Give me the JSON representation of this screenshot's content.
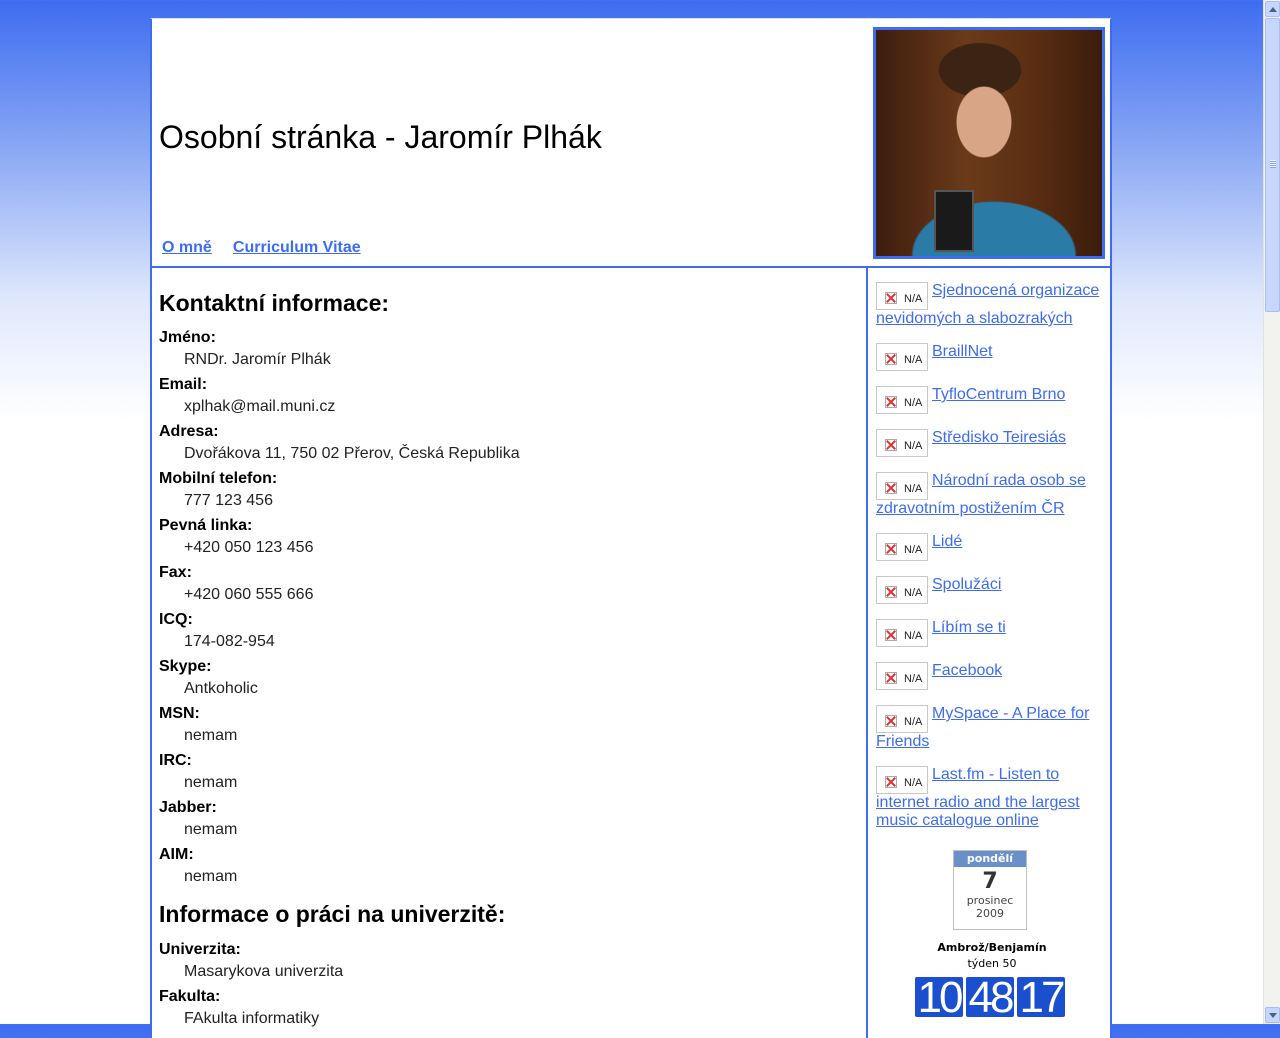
{
  "header": {
    "title": "Osobní stránka - Jaromír Plhák",
    "nav": [
      {
        "label": "O mně"
      },
      {
        "label": "Curriculum Vitae"
      }
    ]
  },
  "contact": {
    "heading": "Kontaktní informace:",
    "fields": [
      {
        "label": "Jméno:",
        "value": "RNDr. Jaromír Plhák"
      },
      {
        "label": "Email:",
        "value": "xplhak@mail.muni.cz"
      },
      {
        "label": "Adresa:",
        "value": "Dvořákova 11, 750 02 Přerov, Česká Republika"
      },
      {
        "label": "Mobilní telefon:",
        "value": "777 123 456"
      },
      {
        "label": "Pevná linka:",
        "value": "+420 050 123 456"
      },
      {
        "label": "Fax:",
        "value": "+420 060 555 666"
      },
      {
        "label": "ICQ:",
        "value": "174-082-954"
      },
      {
        "label": "Skype:",
        "value": "Antkoholic"
      },
      {
        "label": "MSN:",
        "value": "nemam"
      },
      {
        "label": "IRC:",
        "value": "nemam"
      },
      {
        "label": "Jabber:",
        "value": "nemam"
      },
      {
        "label": "AIM:",
        "value": "nemam"
      }
    ]
  },
  "university": {
    "heading": "Informace o práci na univerzitě:",
    "fields": [
      {
        "label": "Univerzita:",
        "value": "Masarykova univerzita"
      },
      {
        "label": "Fakulta:",
        "value": "FAkulta informatiky"
      }
    ]
  },
  "sidebar": {
    "badge_text": "N/A",
    "links": [
      {
        "label": "Sjednocená organizace nevidomých a slabozrakých"
      },
      {
        "label": "BraillNet"
      },
      {
        "label": "TyfloCentrum Brno"
      },
      {
        "label": "Středisko Teiresiás"
      },
      {
        "label": "Národní rada osob se zdravotním postižením ČR"
      },
      {
        "label": "Lidé"
      },
      {
        "label": "Spolužáci"
      },
      {
        "label": "Líbím se ti"
      },
      {
        "label": "Facebook"
      },
      {
        "label": "MySpace - A Place for Friends"
      },
      {
        "label": "Last.fm - Listen to internet radio and the largest music catalogue online"
      }
    ]
  },
  "calendar": {
    "weekday": "pondělí",
    "day": "7",
    "month": "prosinec",
    "year": "2009",
    "names": "Ambrož/Benjamín",
    "week": "týden 50"
  },
  "clock": {
    "hours": "10",
    "minutes": "48",
    "seconds": "17"
  },
  "colors": {
    "accent": "#3d6cf0",
    "clock_bg": "#1a4fcf"
  }
}
